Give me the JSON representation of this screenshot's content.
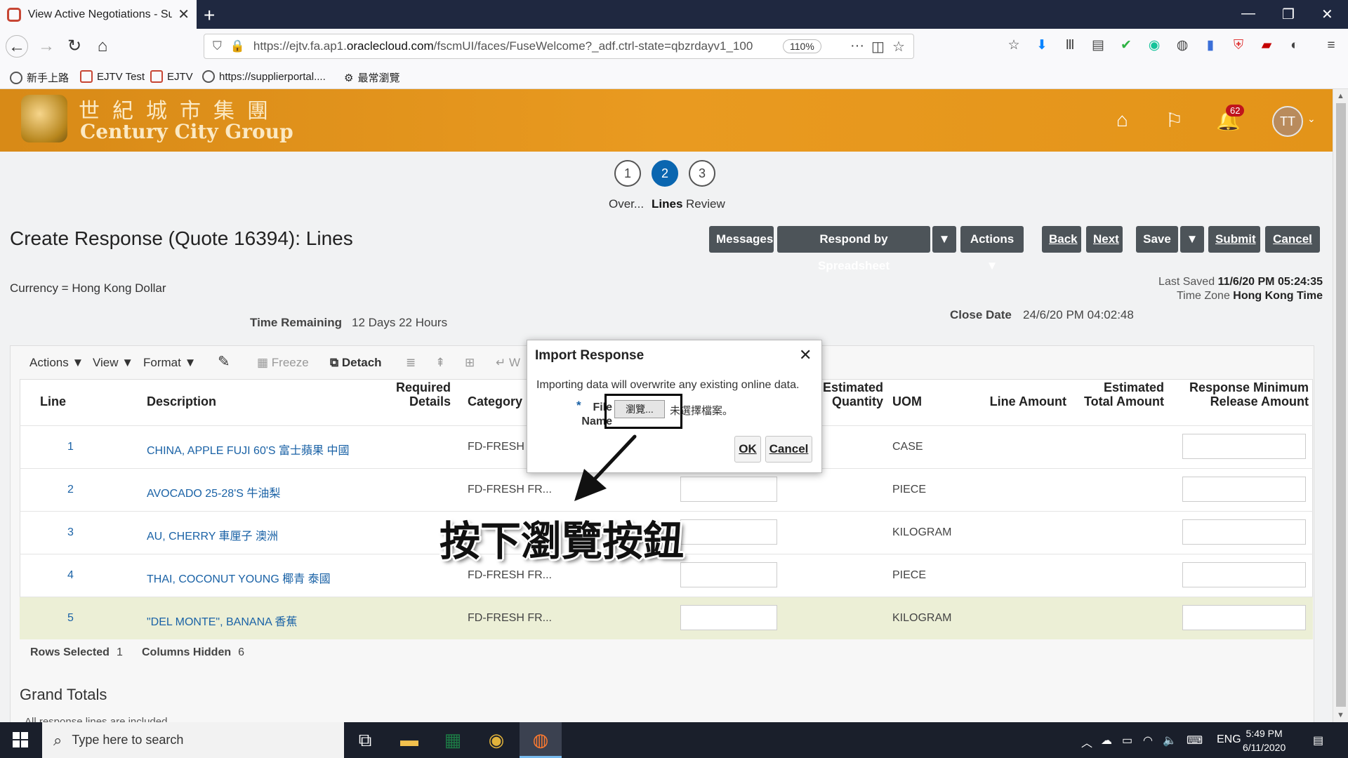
{
  "browser": {
    "tab_title": "View Active Negotiations - Sup",
    "url_prefix": "https://ejtv.fa.ap1.",
    "url_domain": "oraclecloud.com",
    "url_path": "/fscmUI/faces/FuseWelcome?_adf.ctrl-state=qbzrdayv1_100",
    "zoom": "110%",
    "bookmarks": [
      "新手上路",
      "EJTV Test",
      "EJTV",
      "https://supplierportal....",
      "最常瀏覽"
    ]
  },
  "brand": {
    "name_cn": "世紀城市集團",
    "name_en": "Century City Group",
    "notification_count": "62",
    "avatar_initials": "TT"
  },
  "train": {
    "stops": [
      {
        "number": "1",
        "label": "Over..."
      },
      {
        "number": "2",
        "label": "Lines"
      },
      {
        "number": "3",
        "label": "Review"
      }
    ],
    "active_index": 1
  },
  "page": {
    "title": "Create Response (Quote 16394): Lines",
    "currency": "Currency = Hong Kong Dollar",
    "last_saved_label": "Last Saved",
    "last_saved_value": "11/6/20 PM 05:24:35",
    "time_zone_label": "Time Zone",
    "time_zone_value": "Hong Kong Time",
    "time_remaining_label": "Time Remaining",
    "time_remaining_value": "12 Days 22 Hours",
    "close_date_label": "Close Date",
    "close_date_value": "24/6/20 PM 04:02:48"
  },
  "toolbar": {
    "messages": "Messages",
    "respond_by_spreadsheet": "Respond by Spreadsheet",
    "actions": "Actions",
    "back": "Back",
    "next": "Next",
    "save": "Save",
    "submit": "Submit",
    "cancel": "Cancel"
  },
  "table_toolbar": {
    "actions": "Actions",
    "view": "View",
    "format": "Format",
    "freeze": "Freeze",
    "detach": "Detach",
    "wrap_partial": "W"
  },
  "table": {
    "columns": [
      "Line",
      "Description",
      "Required Details",
      "Category",
      "Estimated Quantity",
      "UOM",
      "Line Amount",
      "Estimated Total Amount",
      "Response Minimum Release Amount"
    ],
    "rows": [
      {
        "line": "1",
        "description": "CHINA, APPLE FUJI 60'S 富士蘋果 中國",
        "category": "FD-FRESH",
        "uom": "CASE"
      },
      {
        "line": "2",
        "description": "AVOCADO 25-28'S 牛油梨",
        "category": "FD-FRESH FR...",
        "uom": "PIECE"
      },
      {
        "line": "3",
        "description": "AU, CHERRY 車厘子 澳洲",
        "category": "FD-FRESH FR...",
        "uom": "KILOGRAM"
      },
      {
        "line": "4",
        "description": "THAI, COCONUT YOUNG 椰青 泰國",
        "category": "FD-FRESH FR...",
        "uom": "PIECE"
      },
      {
        "line": "5",
        "description": "\"DEL MONTE\", BANANA 香蕉",
        "category": "FD-FRESH FR...",
        "uom": "KILOGRAM"
      }
    ],
    "selected_row": 5,
    "rows_selected_label": "Rows Selected",
    "rows_selected_value": "1",
    "columns_hidden_label": "Columns Hidden",
    "columns_hidden_value": "6",
    "grand_totals": "Grand Totals",
    "grand_totals_sub": "All response lines are included"
  },
  "dialog": {
    "title": "Import Response",
    "message": "Importing data will overwrite any existing online data.",
    "required_mark": "*",
    "file_label_1": "File",
    "file_label_2": "Name",
    "browse_button": "瀏覽...",
    "no_file": "未選擇檔案。",
    "ok": "OK",
    "cancel": "Cancel"
  },
  "annotation": {
    "text": "按下瀏覽按鈕"
  },
  "taskbar": {
    "search_placeholder": "Type here to search",
    "language": "ENG",
    "time": "5:49 PM",
    "date": "6/11/2020"
  }
}
